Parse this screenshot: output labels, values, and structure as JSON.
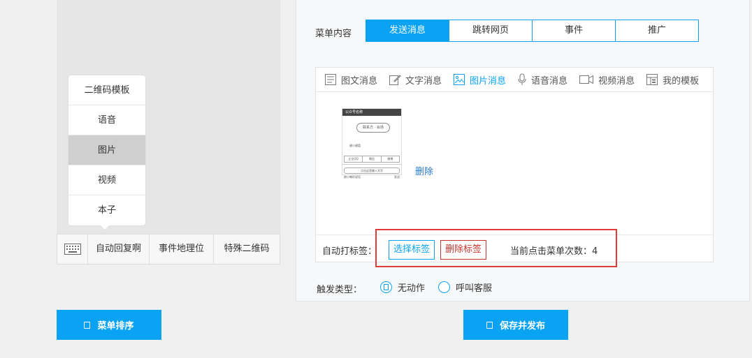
{
  "preview": {
    "submenu_items": [
      {
        "label": "二维码模板",
        "active": false
      },
      {
        "label": "语音",
        "active": false
      },
      {
        "label": "图片",
        "active": true
      },
      {
        "label": "视频",
        "active": false
      },
      {
        "label": "本子",
        "active": false
      }
    ],
    "menu_bar": {
      "keyboard_icon": "keyboard-icon",
      "items": [
        "自动回复啊",
        "事件地理位",
        "特殊二维码"
      ]
    }
  },
  "buttons": {
    "sort_menu": "菜单排序",
    "save_publish": "保存并发布"
  },
  "menu_content": {
    "label": "菜单内容",
    "tabs": [
      {
        "label": "发送消息",
        "active": true
      },
      {
        "label": "跳转网页",
        "active": false
      },
      {
        "label": "事件",
        "active": false
      },
      {
        "label": "推广",
        "active": false
      }
    ]
  },
  "editor": {
    "tools": [
      {
        "label": "图文消息",
        "icon": "article-icon",
        "active": false
      },
      {
        "label": "文字消息",
        "icon": "pencil-icon",
        "active": false
      },
      {
        "label": "图片消息",
        "icon": "image-icon",
        "active": true
      },
      {
        "label": "语音消息",
        "icon": "microphone-icon",
        "active": false
      },
      {
        "label": "视频消息",
        "icon": "video-icon",
        "active": false
      },
      {
        "label": "我的模板",
        "icon": "template-icon",
        "active": false
      }
    ],
    "delete_link": "删除",
    "thumbnail": {
      "header": "公众号名称",
      "bubble": "联系方 · 会场",
      "keyboard_note": "键小键盘",
      "bar_items": [
        "企业QQ",
        "微信",
        "微博"
      ],
      "input_text": "点击这里输入文字",
      "foot_left": "按小喇叭说话",
      "foot_right": "发送"
    }
  },
  "auto_tag": {
    "label": "自动打标签：",
    "select_button": "选择标签",
    "delete_button": "删除标签",
    "click_count_text": "当前点击菜单次数：4"
  },
  "trigger": {
    "label": "触发类型：",
    "options": [
      "无动作",
      "呼叫客服"
    ]
  },
  "colors": {
    "accent": "#0aa3f4",
    "danger": "#c8342c",
    "highlight_box": "#e03a3a"
  }
}
